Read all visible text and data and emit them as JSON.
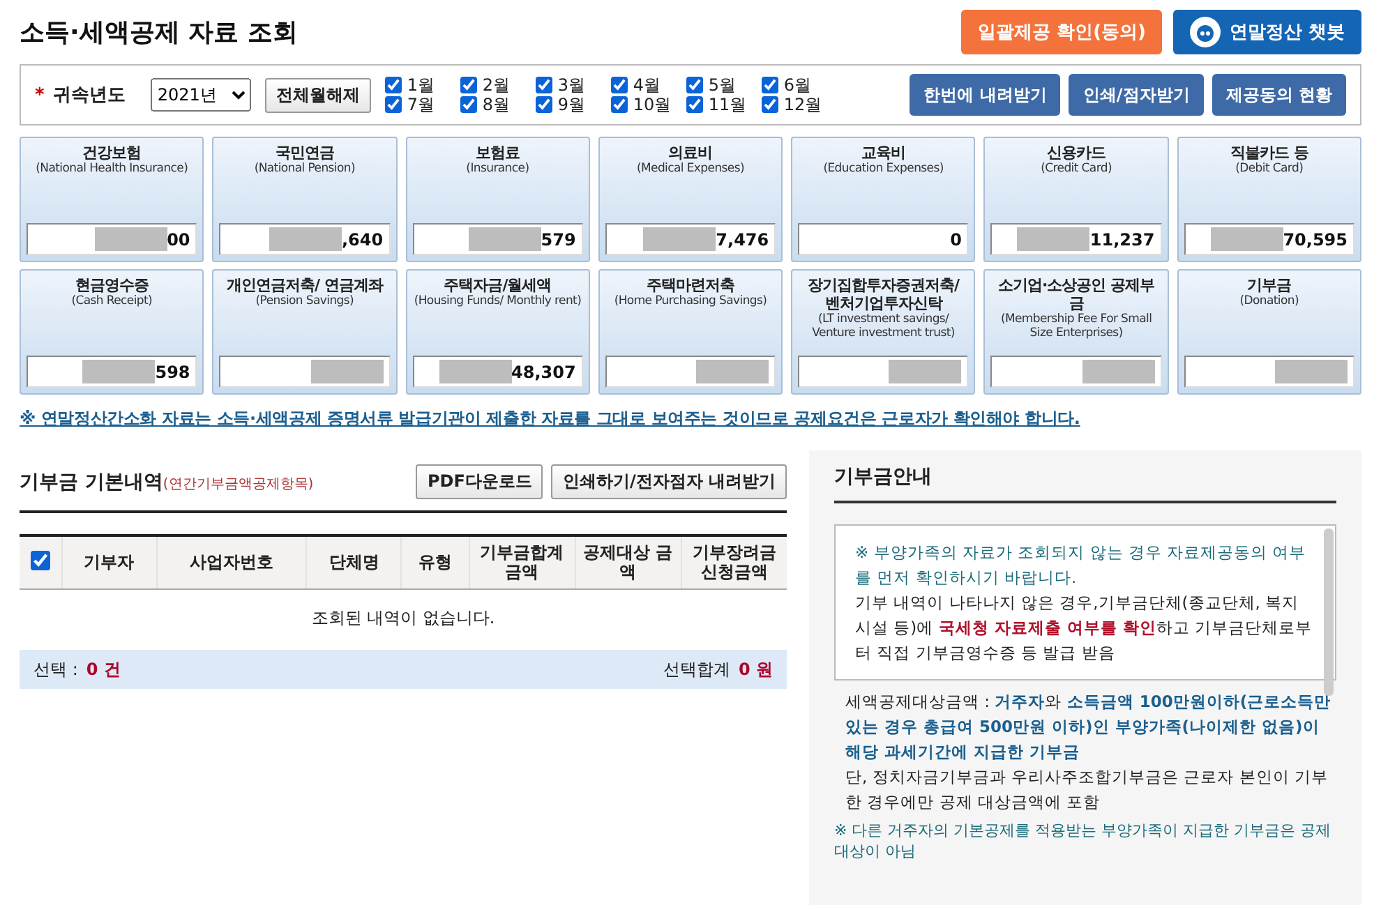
{
  "title": "소득·세액공제 자료 조회",
  "header_buttons": [
    {
      "label": "일괄제공 확인(동의)",
      "kind": "orange"
    },
    {
      "label": "연말정산 챗봇",
      "kind": "chatbot"
    }
  ],
  "filter": {
    "label": "귀속년도",
    "required_mark": "*",
    "year": "2021년",
    "clear_button": "전체월해제",
    "months": [
      {
        "label": "1월",
        "checked": true
      },
      {
        "label": "2월",
        "checked": true
      },
      {
        "label": "3월",
        "checked": true
      },
      {
        "label": "4월",
        "checked": true
      },
      {
        "label": "5월",
        "checked": true
      },
      {
        "label": "6월",
        "checked": true
      },
      {
        "label": "7월",
        "checked": true
      },
      {
        "label": "8월",
        "checked": true
      },
      {
        "label": "9월",
        "checked": true
      },
      {
        "label": "10월",
        "checked": true
      },
      {
        "label": "11월",
        "checked": true
      },
      {
        "label": "12월",
        "checked": true
      }
    ],
    "actions": [
      "한번에 내려받기",
      "인쇄/점자받기",
      "제공동의 현황"
    ]
  },
  "categories": [
    {
      "name": "건강보험",
      "english": "(National Health Insurance)",
      "value": "00",
      "masked": true
    },
    {
      "name": "국민연금",
      "english": "(National Pension)",
      "value": ",640",
      "masked": true
    },
    {
      "name": "보험료",
      "english": "(Insurance)",
      "value": "579",
      "masked": true
    },
    {
      "name": "의료비",
      "english": "(Medical Expenses)",
      "value": "7,476",
      "masked": true
    },
    {
      "name": "교육비",
      "english": "(Education Expenses)",
      "value": "0",
      "masked": false
    },
    {
      "name": "신용카드",
      "english": "(Credit Card)",
      "value": "11,237",
      "masked": true
    },
    {
      "name": "직불카드 등",
      "english": "(Debit Card)",
      "value": "70,595",
      "masked": true
    },
    {
      "name": "현금영수증",
      "english": "(Cash Receipt)",
      "value": "598",
      "masked": true
    },
    {
      "name": "개인연금저축/ 연금계좌",
      "english": "(Pension Savings)",
      "masked": true
    },
    {
      "name": "주택자금/월세액",
      "english": "(Housing Funds/ Monthly rent)",
      "value": "48,307",
      "masked": true
    },
    {
      "name": "주택마련저축",
      "english": "(Home Purchasing Savings)",
      "masked": true
    },
    {
      "name": "장기집합투자증권저축/ 벤처기업투자신탁",
      "english": "(LT investment savings/ Venture investment trust)",
      "masked": true
    },
    {
      "name": "소기업·소상공인 공제부금",
      "english": "(Membership Fee For Small Size Enterprises)",
      "masked": true
    },
    {
      "name": "기부금",
      "english": "(Donation)",
      "masked": true
    }
  ],
  "notice": "※ 연말정산간소화 자료는 소득·세액공제 증명서류 발급기관이 제출한 자료를 그대로 보여주는 것이므로 공제요건은 근로자가 확인해야 합니다.",
  "donation": {
    "title": "기부금 기본내역",
    "subtitle": "(연간기부금액공제항목)",
    "buttons": [
      "PDF다운로드",
      "인쇄하기/전자점자 내려받기"
    ],
    "select_all": true,
    "columns": [
      "기부자",
      "사업자번호",
      "단체명",
      "유형",
      "기부금합계 금액",
      "공제대상 금액",
      "기부장려금 신청금액"
    ],
    "empty": "조회된 내역이 없습니다.",
    "footer": {
      "count_label": "선택 :",
      "count": "0 건",
      "sum_label": "선택합계",
      "sum": "0 원"
    }
  },
  "guide": {
    "title": "기부금안내",
    "box_note": "※ 부양가족의 자료가 조회되지 않는 경우 자료제공동의 여부를 먼저 확인하시기 바랍니다.",
    "box_text": "기부 내역이 나타나지 않은 경우,기부금단체(종교단체, 복지시설 등)에 **국세청 자료제출 여부를 확인**하고 기부금단체로부터 직접 기부금영수증 등 발급 받음",
    "bullet": "세액공제대상금액 : **거주자**와 **소득금액 100만원이하(근로소득만 있는 경우 총급여 500만원 이하)인 부양가족(나이제한 없음)이 해당 과세기간에 지급한 기부금**",
    "bullet_note": "단, 정치자금기부금과 우리사주조합기부금은 근로자 본인이 기부한 경우에만 공제 대상금액에 포함",
    "footnote": "※ 다른 거주자의 기본공제를 적용받는 부양가족이 지급한 기부금은 공제대상이 아님"
  }
}
